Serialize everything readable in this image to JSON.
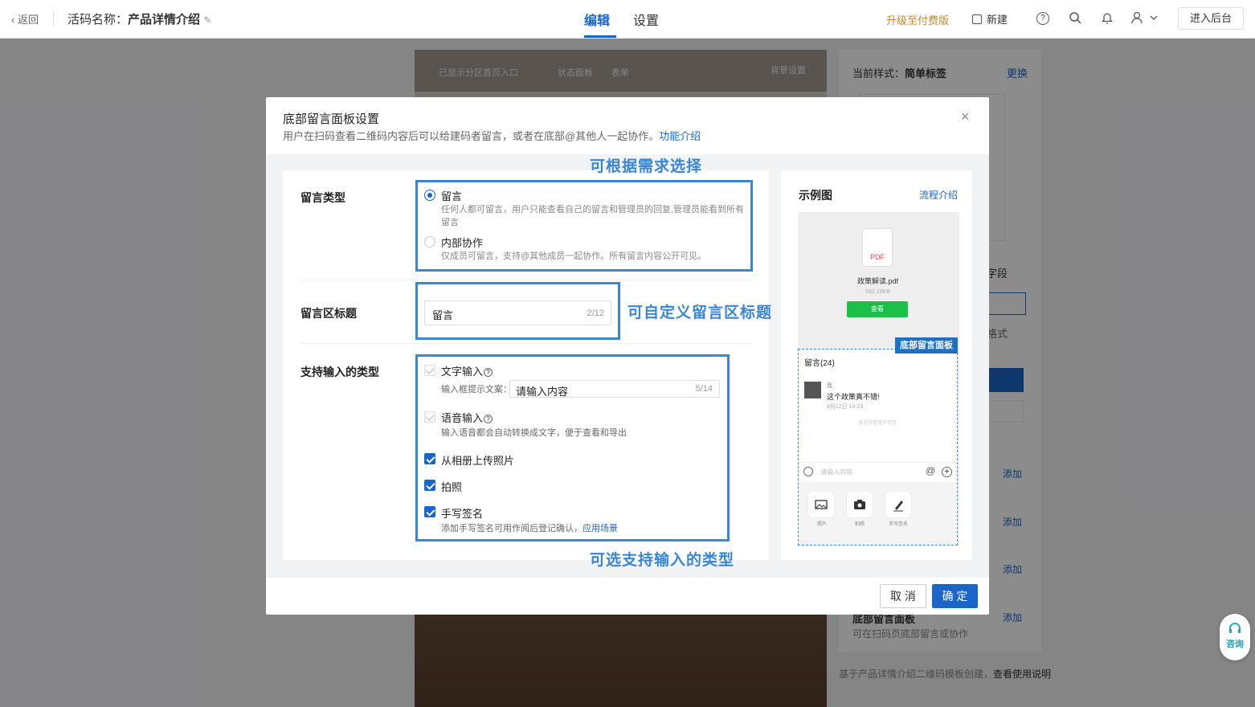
{
  "topbar": {
    "back": "返回",
    "title_prefix": "活码名称：",
    "title_name": "产品详情介绍",
    "tabs": [
      "编辑",
      "设置"
    ],
    "upgrade": "升级至付费版",
    "new": "新建",
    "enter_backend": "进入后台"
  },
  "bg": {
    "canvas_toolbar": [
      "已显示分区首页入口",
      "状态面板",
      "表单",
      "背景设置"
    ],
    "rpanel_style_label": "当前样式：",
    "rpanel_style_value": "简单标签",
    "rpanel_change": "更换",
    "rpanel_field": "字段",
    "rpanel_format": "格式",
    "rpanel_add": "添加",
    "rpanel_panel_title": "底部留言面板",
    "rpanel_panel_desc": "可在扫码页底部留言或协作",
    "rpanel_footer": "基于产品详情介绍二维码模板创建，",
    "rpanel_footer_link": "查看使用说明"
  },
  "modal": {
    "title": "底部留言面板设置",
    "desc": "用户在扫码查看二维码内容后可以给建码者留言，或者在底部@其他人一起协作。",
    "desc_link": "功能介绍",
    "type_label": "留言类型",
    "opt1_title": "留言",
    "opt1_desc": "任何人都可留言，用户只能查看自己的留言和管理员的回复,管理员能看到所有留言",
    "opt2_title": "内部协作",
    "opt2_desc": "仅成员可留言，支持@其他成员一起协作。所有留言内容公开可见。",
    "area_label": "留言区标题",
    "area_value": "留言",
    "area_count": "2/12",
    "input_label": "支持输入的类型",
    "text_input": "文字输入",
    "hint_label": "输入框提示文案：",
    "hint_value": "请输入内容",
    "hint_count": "5/14",
    "voice_input": "语音输入",
    "voice_desc": "输入语音都会自动转换成文字，便于查看和导出",
    "photo_upload": "从相册上传照片",
    "take_photo": "拍照",
    "signature": "手写签名",
    "signature_desc": "添加手写签名可用作阅后登记确认，",
    "signature_link": "应用场景",
    "cancel": "取 消",
    "ok": "确 定"
  },
  "annotations": {
    "a1": "可根据需求选择",
    "a2": "可自定义留言区标题",
    "a3": "可选支持输入的类型"
  },
  "example": {
    "title": "示例图",
    "link": "流程介绍",
    "pdf_tag": "PDF",
    "file_name": "政策解读.pdf",
    "file_size": "592.19KB",
    "view_btn": "查看",
    "badge": "底部留言面板",
    "comment_header": "留言(24)",
    "comment_user": "我",
    "comment_text": "这个政策真不错!",
    "comment_time": "8月12日 14:23",
    "comment_note": "留言仅管理员可见",
    "input_placeholder": "请输入内容",
    "tools": [
      "照片",
      "拍照",
      "手写签名"
    ]
  },
  "consult": "咨询"
}
